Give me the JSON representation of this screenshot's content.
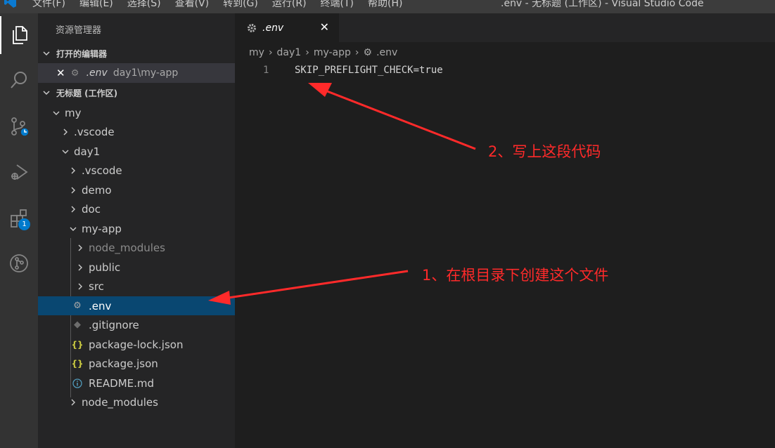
{
  "titlebar": {
    "menu": [
      "文件(F)",
      "编辑(E)",
      "选择(S)",
      "查看(V)",
      "转到(G)",
      "运行(R)",
      "终端(T)",
      "帮助(H)"
    ],
    "window_title": ".env - 无标题 (工作区) - Visual Studio Code"
  },
  "activitybar": {
    "icons": [
      "explorer-icon",
      "search-icon",
      "source-control-icon",
      "run-debug-icon",
      "extensions-icon",
      "git-graph-icon"
    ],
    "extensions_badge": "1"
  },
  "sidebar": {
    "title": "资源管理器",
    "open_editors": {
      "header": "打开的编辑器",
      "items": [
        {
          "name": ".env",
          "path": "day1\\my-app"
        }
      ]
    },
    "workspace": {
      "header": "无标题 (工作区)",
      "tree": [
        {
          "label": "my",
          "kind": "folder-open"
        },
        {
          "label": ".vscode",
          "kind": "folder"
        },
        {
          "label": "day1",
          "kind": "folder-open"
        },
        {
          "label": ".vscode",
          "kind": "folder"
        },
        {
          "label": "demo",
          "kind": "folder"
        },
        {
          "label": "doc",
          "kind": "folder"
        },
        {
          "label": "my-app",
          "kind": "folder-open"
        },
        {
          "label": "node_modules",
          "kind": "folder"
        },
        {
          "label": "public",
          "kind": "folder"
        },
        {
          "label": "src",
          "kind": "folder"
        },
        {
          "label": ".env",
          "kind": "gear-file"
        },
        {
          "label": ".gitignore",
          "kind": "git-file"
        },
        {
          "label": "package-lock.json",
          "kind": "json-file"
        },
        {
          "label": "package.json",
          "kind": "json-file"
        },
        {
          "label": "README.md",
          "kind": "info-file"
        },
        {
          "label": "node_modules",
          "kind": "folder"
        }
      ]
    }
  },
  "editor": {
    "tab": {
      "label": ".env"
    },
    "breadcrumb": [
      "my",
      "day1",
      "my-app",
      ".env"
    ],
    "lines": [
      {
        "number": "1",
        "text": "SKIP_PREFLIGHT_CHECK=true"
      }
    ]
  },
  "annotations": {
    "step1": "1、在根目录下创建这个文件",
    "step2": "2、写上这段代码"
  },
  "colors": {
    "accent": "#007acc",
    "selection": "#094771",
    "annotation": "#ff2a2a"
  }
}
